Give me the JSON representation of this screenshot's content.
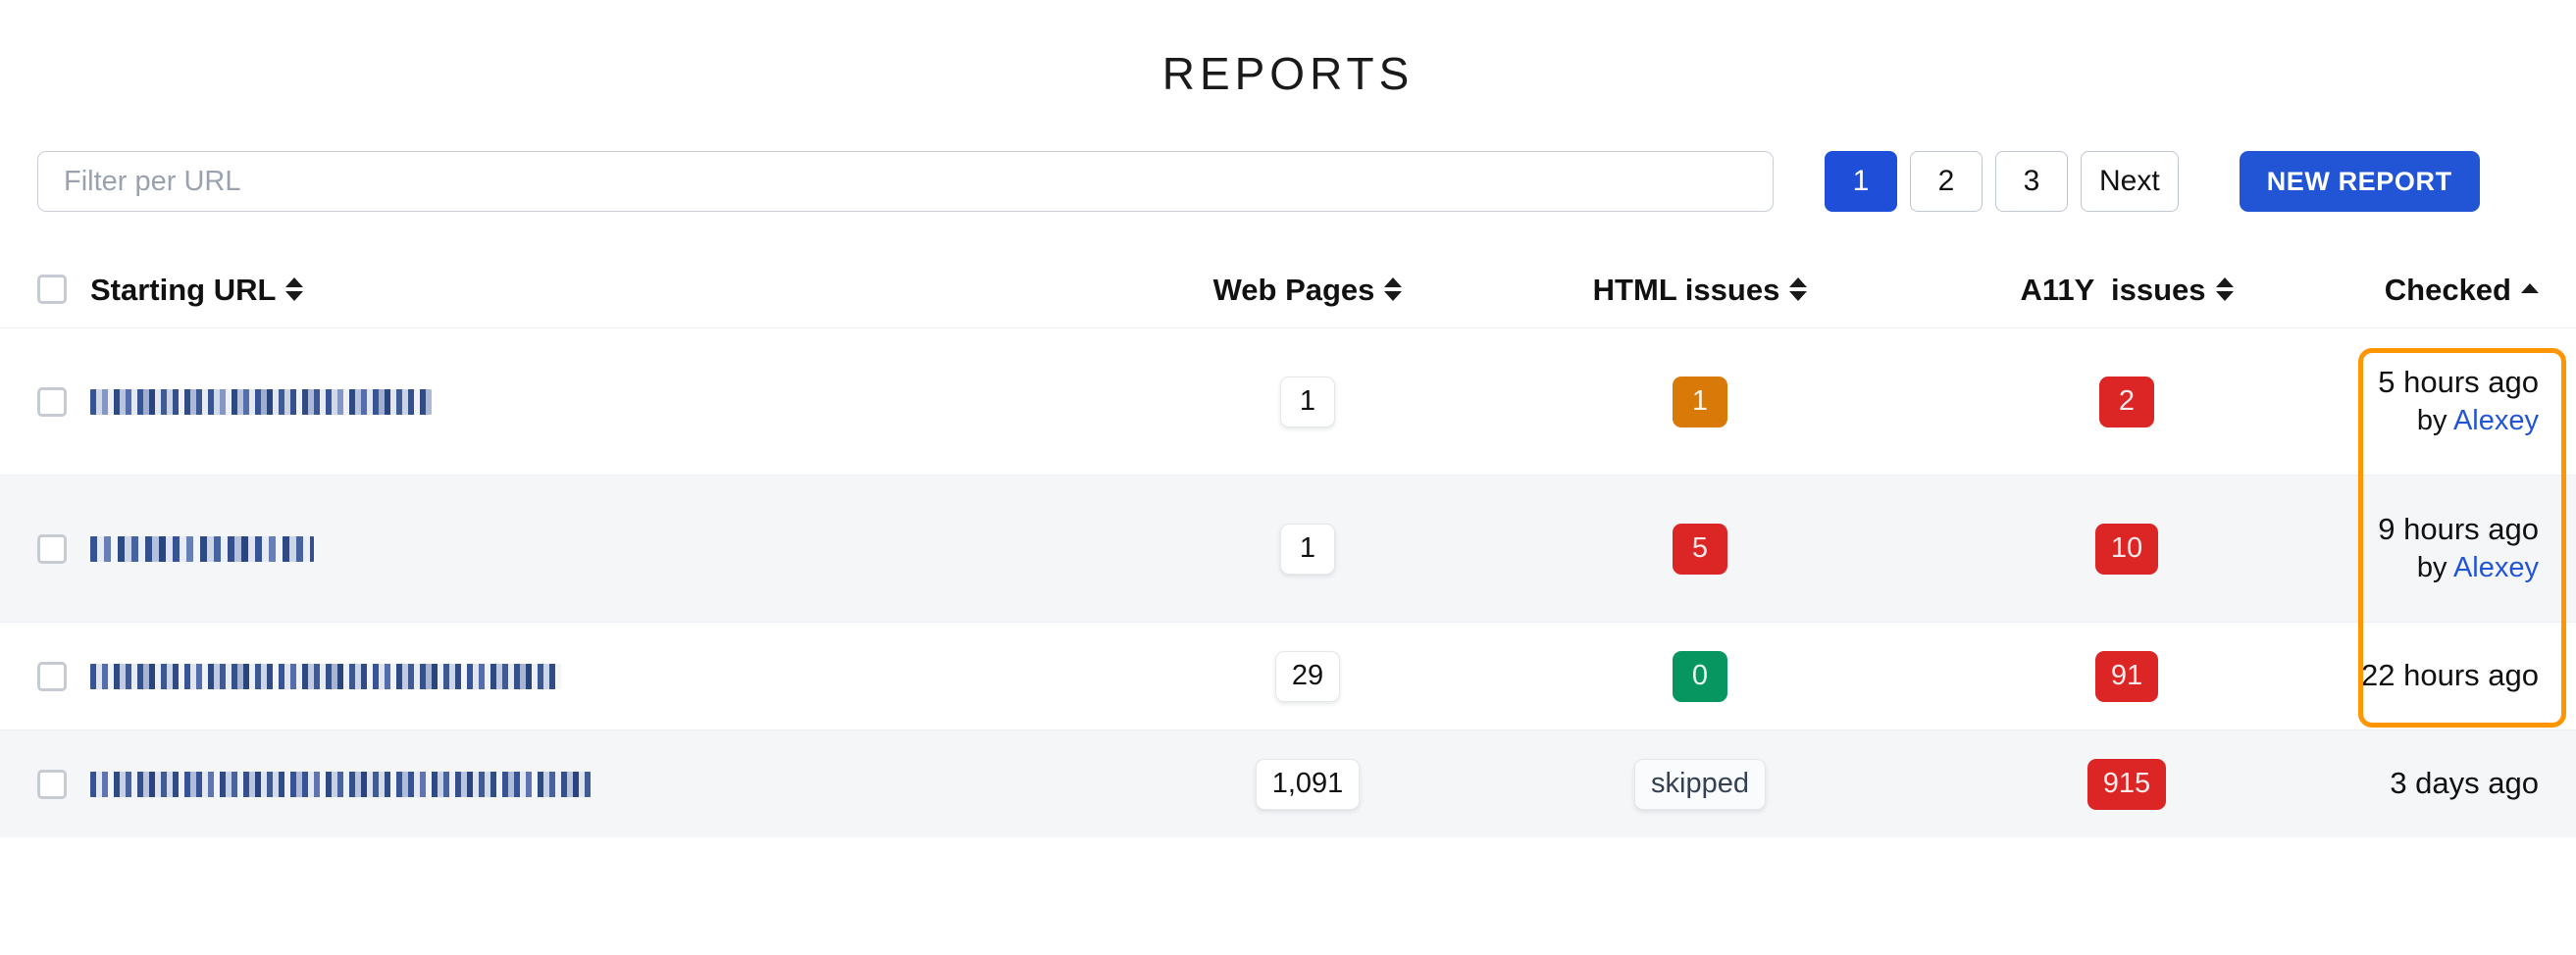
{
  "header": {
    "title": "REPORTS"
  },
  "toolbar": {
    "filter_placeholder": "Filter per URL",
    "filter_value": "",
    "pagination": [
      {
        "label": "1",
        "active": true
      },
      {
        "label": "2",
        "active": false
      },
      {
        "label": "3",
        "active": false
      },
      {
        "label": "Next",
        "active": false
      }
    ],
    "new_report_label": "NEW REPORT"
  },
  "table": {
    "columns": [
      {
        "key": "url",
        "label": "Starting URL",
        "sort": "none"
      },
      {
        "key": "pages",
        "label": "Web Pages",
        "sort": "none"
      },
      {
        "key": "html",
        "label": "HTML issues",
        "sort": "none"
      },
      {
        "key": "a11y",
        "label": "A11Y  issues",
        "sort": "none"
      },
      {
        "key": "chk",
        "label": "Checked",
        "sort": "asc"
      }
    ],
    "rows": [
      {
        "url": "",
        "pages": "1",
        "html": "1",
        "html_style": "orange",
        "a11y": "2",
        "a11y_style": "red",
        "checked_when": "5 hours ago",
        "checked_by_prefix": "by ",
        "checked_by": "Alexey"
      },
      {
        "url": "",
        "pages": "1",
        "html": "5",
        "html_style": "red",
        "a11y": "10",
        "a11y_style": "red",
        "checked_when": "9 hours ago",
        "checked_by_prefix": "by ",
        "checked_by": "Alexey"
      },
      {
        "url": "",
        "pages": "29",
        "html": "0",
        "html_style": "green",
        "a11y": "91",
        "a11y_style": "red",
        "checked_when": "22 hours ago",
        "checked_by_prefix": "",
        "checked_by": ""
      },
      {
        "url": "",
        "pages": "1,091",
        "html": "skipped",
        "html_style": "muted",
        "a11y": "915",
        "a11y_style": "red",
        "checked_when": "3 days ago",
        "checked_by_prefix": "",
        "checked_by": ""
      }
    ]
  },
  "colors": {
    "primary": "#2255d6",
    "pager_active": "#1f4fd8",
    "badge_orange": "#d97908",
    "badge_red": "#dc2626",
    "badge_green": "#089660",
    "highlight": "#ff9500",
    "link": "#2255d6"
  },
  "annotation": {
    "highlight_target": "Checked"
  }
}
